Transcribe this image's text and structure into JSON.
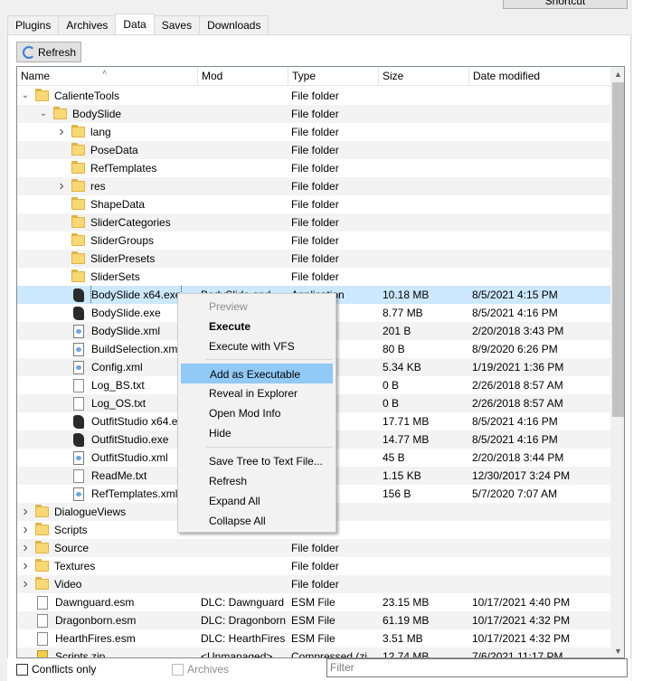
{
  "window": {
    "shortcut_label": "Shortcut"
  },
  "tabs": [
    {
      "label": "Plugins"
    },
    {
      "label": "Archives"
    },
    {
      "label": "Data"
    },
    {
      "label": "Saves"
    },
    {
      "label": "Downloads"
    }
  ],
  "toolbar": {
    "refresh_label": "Refresh"
  },
  "columns": {
    "name": "Name",
    "mod": "Mod",
    "type": "Type",
    "size": "Size",
    "date": "Date modified"
  },
  "rows": [
    {
      "name": "CalienteTools",
      "mod": "",
      "type": "File folder",
      "size": "",
      "date": ""
    },
    {
      "name": "BodySlide",
      "mod": "",
      "type": "File folder",
      "size": "",
      "date": ""
    },
    {
      "name": "lang",
      "mod": "",
      "type": "File folder",
      "size": "",
      "date": ""
    },
    {
      "name": "PoseData",
      "mod": "",
      "type": "File folder",
      "size": "",
      "date": ""
    },
    {
      "name": "RefTemplates",
      "mod": "",
      "type": "File folder",
      "size": "",
      "date": ""
    },
    {
      "name": "res",
      "mod": "",
      "type": "File folder",
      "size": "",
      "date": ""
    },
    {
      "name": "ShapeData",
      "mod": "",
      "type": "File folder",
      "size": "",
      "date": ""
    },
    {
      "name": "SliderCategories",
      "mod": "",
      "type": "File folder",
      "size": "",
      "date": ""
    },
    {
      "name": "SliderGroups",
      "mod": "",
      "type": "File folder",
      "size": "",
      "date": ""
    },
    {
      "name": "SliderPresets",
      "mod": "",
      "type": "File folder",
      "size": "",
      "date": ""
    },
    {
      "name": "SliderSets",
      "mod": "",
      "type": "File folder",
      "size": "",
      "date": ""
    },
    {
      "name": "BodySlide x64.exe",
      "mod": "BodySlide and",
      "type": "Application",
      "size": "10.18 MB",
      "date": "8/5/2021 4:15 PM"
    },
    {
      "name": "BodySlide.exe",
      "mod": "",
      "type": "ion",
      "size": "8.77 MB",
      "date": "8/5/2021 4:16 PM"
    },
    {
      "name": "BodySlide.xml",
      "mod": "",
      "type": "ument",
      "size": "201 B",
      "date": "2/20/2018 3:43 PM"
    },
    {
      "name": "BuildSelection.xml",
      "mod": "",
      "type": "ument",
      "size": "80 B",
      "date": "8/9/2020 6:26 PM"
    },
    {
      "name": "Config.xml",
      "mod": "",
      "type": "ument",
      "size": "5.34 KB",
      "date": "1/19/2021 1:36 PM"
    },
    {
      "name": "Log_BS.txt",
      "mod": "",
      "type": "ument",
      "size": "0 B",
      "date": "2/26/2018 8:57 AM"
    },
    {
      "name": "Log_OS.txt",
      "mod": "",
      "type": "ument",
      "size": "0 B",
      "date": "2/26/2018 8:57 AM"
    },
    {
      "name": "OutfitStudio x64.exe",
      "mod": "",
      "type": "ion",
      "size": "17.71 MB",
      "date": "8/5/2021 4:16 PM"
    },
    {
      "name": "OutfitStudio.exe",
      "mod": "",
      "type": "ion",
      "size": "14.77 MB",
      "date": "8/5/2021 4:16 PM"
    },
    {
      "name": "OutfitStudio.xml",
      "mod": "",
      "type": "ument",
      "size": "45 B",
      "date": "2/20/2018 3:44 PM"
    },
    {
      "name": "ReadMe.txt",
      "mod": "",
      "type": "ument",
      "size": "1.15 KB",
      "date": "12/30/2017 3:24 PM"
    },
    {
      "name": "RefTemplates.xml",
      "mod": "",
      "type": "ument",
      "size": "156 B",
      "date": "5/7/2020 7:07 AM"
    },
    {
      "name": "DialogueViews",
      "mod": "",
      "type": "",
      "size": "",
      "date": ""
    },
    {
      "name": "Scripts",
      "mod": "",
      "type": "",
      "size": "",
      "date": ""
    },
    {
      "name": "Source",
      "mod": "",
      "type": "File folder",
      "size": "",
      "date": ""
    },
    {
      "name": "Textures",
      "mod": "",
      "type": "File folder",
      "size": "",
      "date": ""
    },
    {
      "name": "Video",
      "mod": "",
      "type": "File folder",
      "size": "",
      "date": ""
    },
    {
      "name": "Dawnguard.esm",
      "mod": "DLC: Dawnguard",
      "type": "ESM File",
      "size": "23.15 MB",
      "date": "10/17/2021 4:40 PM"
    },
    {
      "name": "Dragonborn.esm",
      "mod": "DLC: Dragonborn",
      "type": "ESM File",
      "size": "61.19 MB",
      "date": "10/17/2021 4:32 PM"
    },
    {
      "name": "HearthFires.esm",
      "mod": "DLC: HearthFires",
      "type": "ESM File",
      "size": "3.51 MB",
      "date": "10/17/2021 4:32 PM"
    },
    {
      "name": "Scripts.zip",
      "mod": "<Unmanaged>",
      "type": "Compressed (zi",
      "size": "12.74 MB",
      "date": "7/6/2021 11:17 PM"
    }
  ],
  "context_menu": [
    {
      "label": "Preview"
    },
    {
      "label": "Execute"
    },
    {
      "label": "Execute with VFS"
    },
    {
      "label": "Add as Executable"
    },
    {
      "label": "Reveal in Explorer"
    },
    {
      "label": "Open Mod Info"
    },
    {
      "label": "Hide"
    },
    {
      "label": "Save Tree to Text File..."
    },
    {
      "label": "Refresh"
    },
    {
      "label": "Expand All"
    },
    {
      "label": "Collapse All"
    }
  ],
  "footer": {
    "conflicts_only_label": "Conflicts only",
    "archives_label": "Archives",
    "filter_placeholder": "Filter"
  },
  "colors": {
    "selection": "#cce8ff",
    "menu_highlight": "#91c9f7",
    "folder": "#f8d775"
  }
}
